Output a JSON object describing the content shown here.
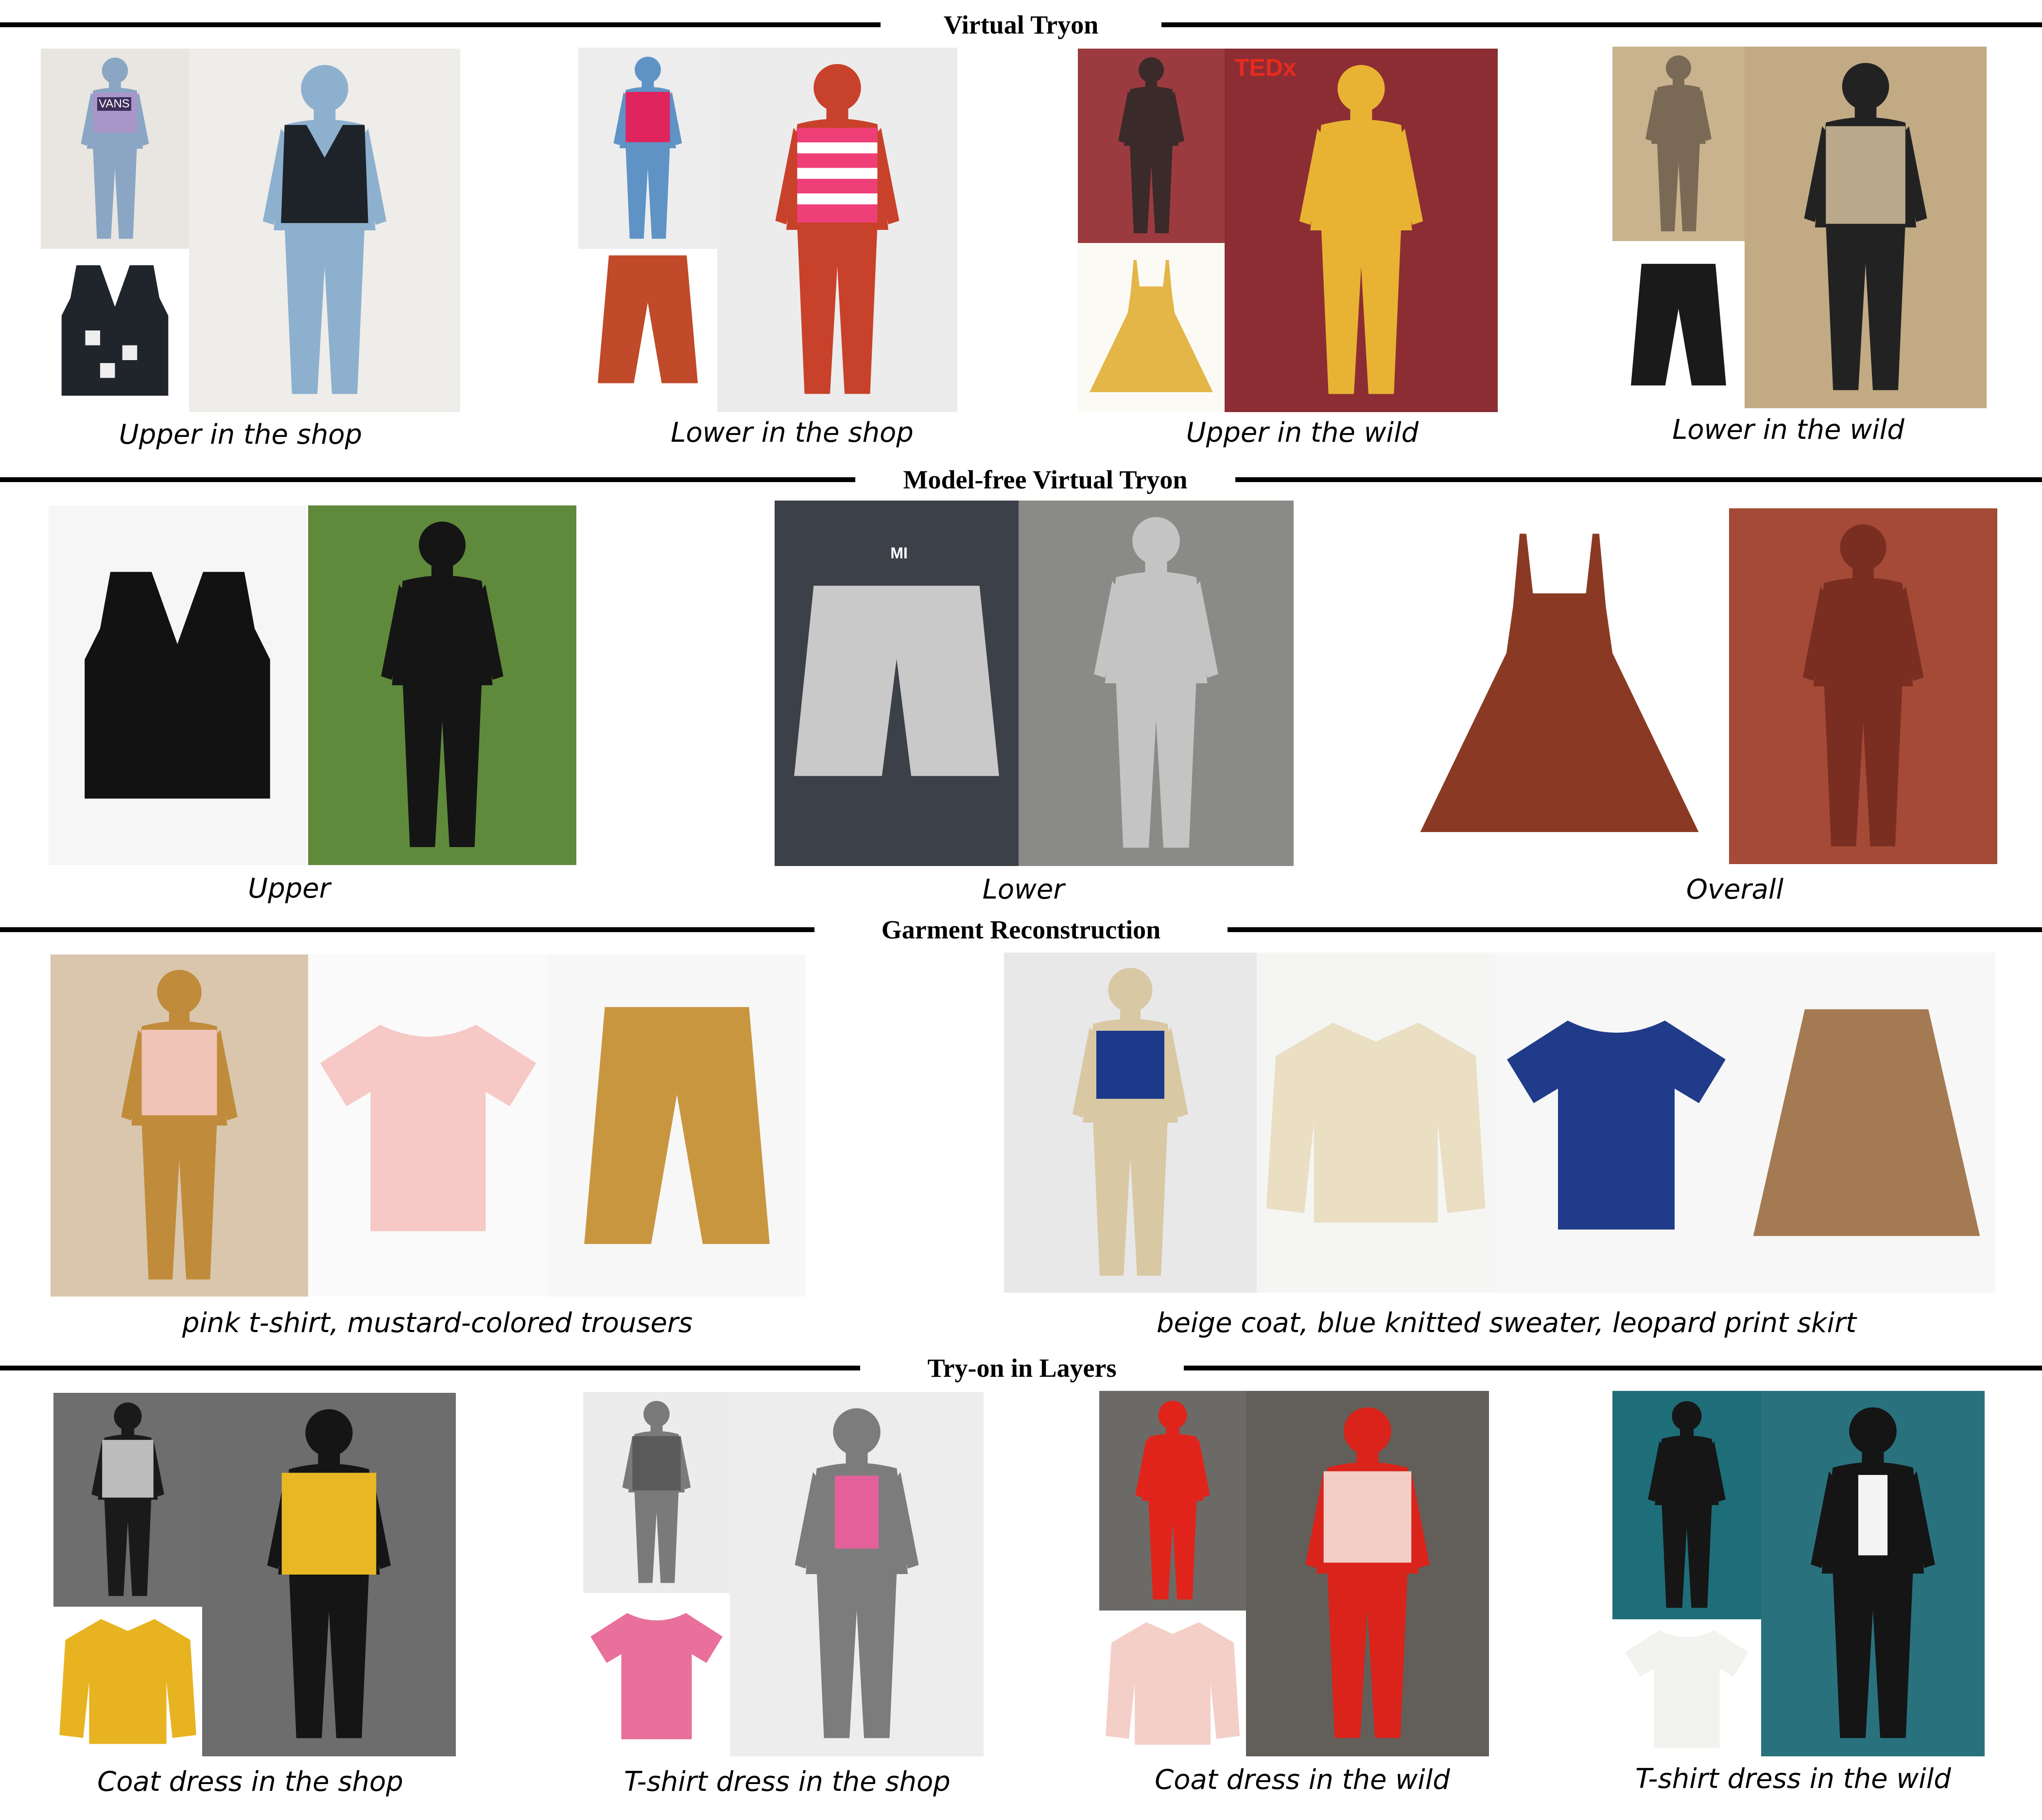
{
  "sections": {
    "virtual_tryon": {
      "title": "Virtual Tryon",
      "captions": [
        "Upper in the shop",
        "Lower in the shop",
        "Upper in the wild",
        "Lower in the wild"
      ]
    },
    "model_free": {
      "title": "Model-free Virtual Tryon",
      "captions": [
        "Upper",
        "Lower",
        "Overall"
      ]
    },
    "garment_reconstruction": {
      "title": "Garment Reconstruction",
      "captions": [
        "pink t-shirt, mustard-colored trousers",
        "beige coat, blue knitted sweater, leopard print skirt"
      ]
    },
    "tryon_layers": {
      "title": "Try-on in Layers",
      "captions": [
        "Coat dress in the shop",
        "T-shirt dress in the shop",
        "Coat dress in the wild",
        "T-shirt dress in the wild"
      ]
    }
  },
  "image_text": {
    "vans_logo": "VANS",
    "tedx_sign": "TEDx",
    "hanger_label": "MI"
  }
}
